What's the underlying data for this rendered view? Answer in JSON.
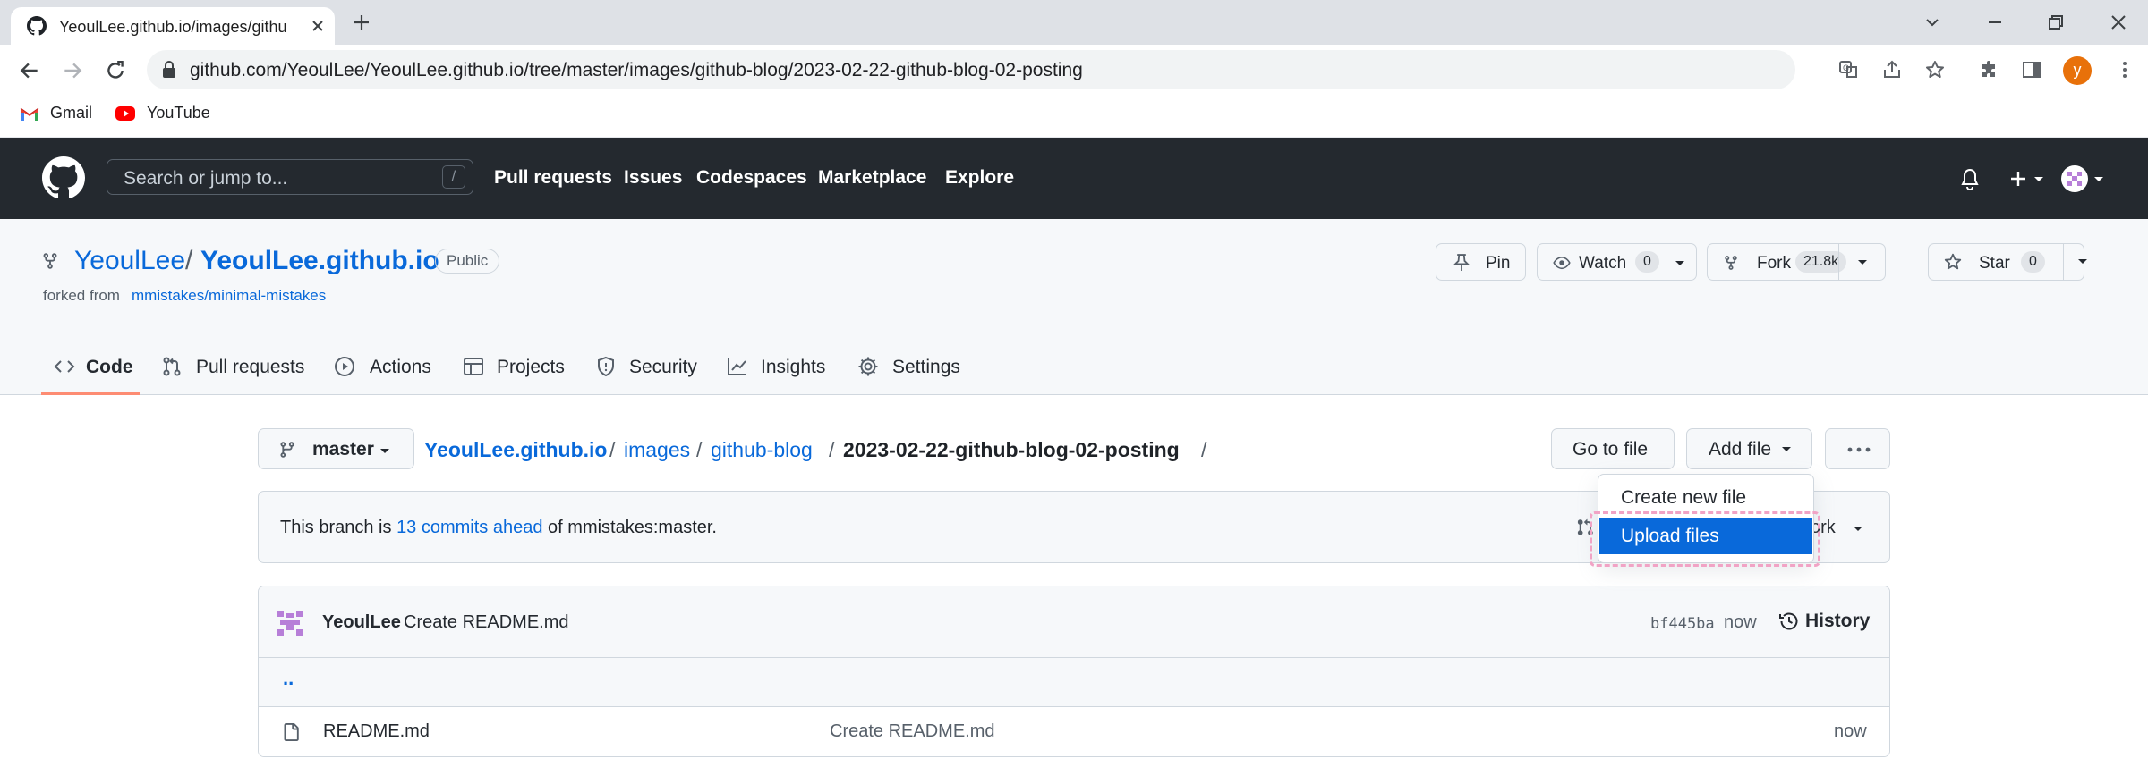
{
  "browser": {
    "tab_title": "YeoulLee.github.io/images/githu",
    "url": "github.com/YeoulLee/YeoulLee.github.io/tree/master/images/github-blog/2023-02-22-github-blog-02-posting",
    "profile_initial": "y",
    "bookmarks": [
      {
        "label": "Gmail",
        "icon": "gmail-icon"
      },
      {
        "label": "YouTube",
        "icon": "youtube-icon"
      }
    ]
  },
  "header": {
    "search_placeholder": "Search or jump to...",
    "search_shortcut": "/",
    "nav": [
      "Pull requests",
      "Issues",
      "Codespaces",
      "Marketplace",
      "Explore"
    ]
  },
  "repo": {
    "owner": "YeoulLee",
    "separator": "/",
    "name": "YeoulLee.github.io",
    "visibility": "Public",
    "forked_prefix": "forked from",
    "forked_from": "mmistakes/minimal-mistakes",
    "pin_label": "Pin",
    "watch_label": "Watch",
    "watch_count": "0",
    "fork_label": "Fork",
    "fork_count": "21.8k",
    "star_label": "Star",
    "star_count": "0"
  },
  "tabs": [
    {
      "label": "Code",
      "icon": "code-icon",
      "selected": true
    },
    {
      "label": "Pull requests",
      "icon": "pull-request-icon"
    },
    {
      "label": "Actions",
      "icon": "play-icon"
    },
    {
      "label": "Projects",
      "icon": "table-icon"
    },
    {
      "label": "Security",
      "icon": "shield-icon"
    },
    {
      "label": "Insights",
      "icon": "graph-icon"
    },
    {
      "label": "Settings",
      "icon": "gear-icon"
    }
  ],
  "toolbar": {
    "branch": "master",
    "breadcrumb": {
      "root": "YeoulLee.github.io",
      "sep": "/",
      "seg1": "images",
      "seg2": "github-blog",
      "current": "2023-02-22-github-blog-02-posting",
      "trail": "/"
    },
    "go_to_file": "Go to file",
    "add_file": "Add file",
    "more": "···"
  },
  "add_file_menu": {
    "items": [
      "Create new file",
      "Upload files"
    ],
    "selected": "Upload files"
  },
  "ahead": {
    "prefix": "This branch is",
    "link": "13 commits ahead",
    "suffix": "of mmistakes:master.",
    "contribute_partial": "ork"
  },
  "commit": {
    "author": "YeoulLee",
    "message": "Create README.md",
    "sha": "bf445ba",
    "time": "now",
    "history": "History"
  },
  "files": {
    "up": "..",
    "rows": [
      {
        "name": "README.md",
        "message": "Create README.md",
        "time": "now"
      }
    ]
  },
  "colors": {
    "header_bg": "#24292f",
    "link": "#0969da",
    "selected_tab_underline": "#fd8c73",
    "menu_selected": "#0969da",
    "highlight_border": "#f1a3c5",
    "profile_avatar": "#e8710a"
  }
}
